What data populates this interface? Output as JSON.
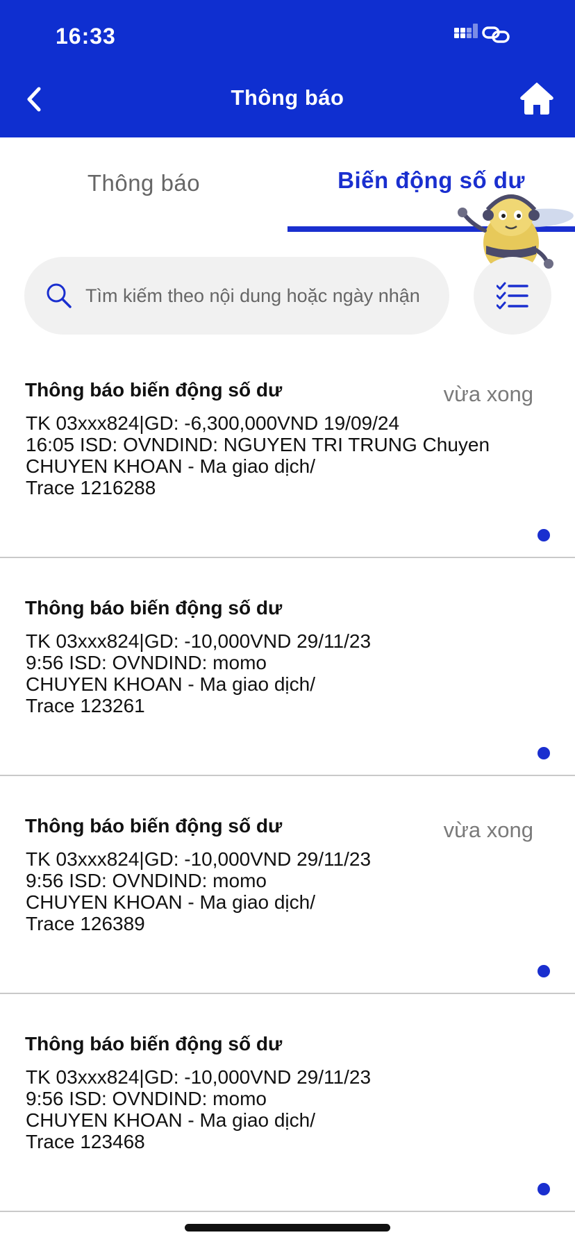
{
  "status_bar": {
    "time": "16:33"
  },
  "header": {
    "title": "Thông báo"
  },
  "tabs": [
    {
      "label": "Thông báo",
      "active": false
    },
    {
      "label": "Biến động số dư",
      "active": true
    }
  ],
  "search": {
    "placeholder": "Tìm kiếm theo nội dung hoặc ngày nhận",
    "value": ""
  },
  "notifications": [
    {
      "title": "Thông báo biến động số dư",
      "time": "vừa xong",
      "body": "TK 03xxx824|GD: -6,300,000VND 19/09/24\n16:05 ISD: OVNDIND: NGUYEN TRI TRUNG Chuyen\nCHUYEN KHOAN - Ma giao dịch/\nTrace 1216288",
      "unread": true
    },
    {
      "title": "Thông báo biến động số dư",
      "time": "",
      "body": "TK 03xxx824|GD: -10,000VND 29/11/23\n9:56 ISD: OVNDIND: momo\nCHUYEN KHOAN - Ma giao dịch/\nTrace 123261",
      "unread": true
    },
    {
      "title": "Thông báo biến động số dư",
      "time": "vừa xong",
      "body": "TK 03xxx824|GD: -10,000VND 29/11/23\n9:56 ISD: OVNDIND: momo\nCHUYEN KHOAN - Ma giao dịch/\nTrace 126389",
      "unread": true
    },
    {
      "title": "Thông báo biến động số dư",
      "time": "",
      "body": "TK 03xxx824|GD: -10,000VND 29/11/23\n9:56 ISD: OVNDIND: momo\nCHUYEN KHOAN - Ma giao dịch/\nTrace 123468",
      "unread": true
    }
  ],
  "icons": {
    "back": "chevron-left-icon",
    "home": "home-icon",
    "search": "search-icon",
    "filter": "checklist-icon",
    "signal": "cellular-signal-icon",
    "link": "link-icon",
    "mascot": "bee-mascot"
  },
  "colors": {
    "primary": "#0f2fd0",
    "accent": "#1a2fcf",
    "unread_dot": "#1a2fcf",
    "search_bg": "#f1f1f1"
  }
}
